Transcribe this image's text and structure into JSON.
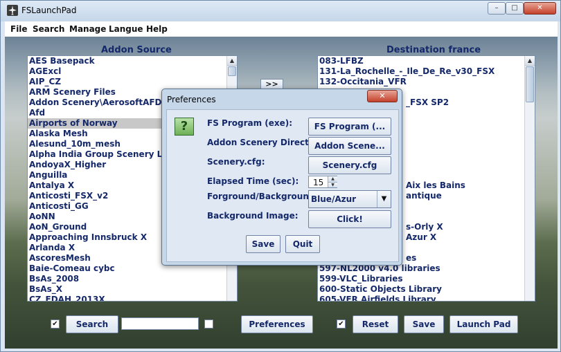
{
  "window": {
    "title": "FSLaunchPad",
    "controls": {
      "minimize": "–",
      "maximize": "□",
      "close": "✕"
    }
  },
  "menu": [
    "File",
    "Search",
    "Manage",
    "Langue",
    "Help"
  ],
  "source": {
    "title": "Addon Source",
    "items": [
      "AES Basepack",
      "AGExcl",
      "AIP_CZ",
      "ARM Scenery Files",
      "Addon Scenery\\AerosoftAFD",
      "Afd",
      "Airports of Norway",
      "Alaska Mesh",
      "Alesund_10m_mesh",
      "Alpha India Group Scenery Landclass",
      "AndoyaX_Higher",
      "Anguilla",
      "Antalya X",
      "Anticosti_FSX_v2",
      "Anticosti_GG",
      "AoNN",
      "AoN_Ground",
      "Approaching Innsbruck X",
      "Arlanda X",
      "AscoresMesh",
      "Baie-Comeau cybc",
      "BsAs_2008",
      "BsAs_X",
      "CZ_EDAH_2013X"
    ],
    "selected_index": 6
  },
  "destination": {
    "title": "Destination france",
    "items_top": [
      "083-LFBZ",
      "131-La_Rochelle_-_Ile_De_Re_v30_FSX",
      "132-Occitania_VFR"
    ],
    "partial_visible": [
      {
        "text": "_FSX SP2",
        "row": 4
      },
      {
        "text": "Aix les Bains",
        "row": 12
      },
      {
        "text": "antique",
        "row": 13
      },
      {
        "text": "s-Orly X",
        "row": 16
      },
      {
        "text": "Azur X",
        "row": 17
      },
      {
        "text": "es",
        "row": 19
      }
    ],
    "items_bottom": [
      "597-NL2000 v4.0 libraries",
      "599-VLC_Libraries",
      "600-Static Objects Library",
      "605-VFR Airfields Library"
    ]
  },
  "transfer_button": ">>",
  "toolbar": {
    "search_checked": true,
    "search_label": "Search",
    "search_value": "",
    "option_checked": false,
    "preferences_label": "Preferences",
    "reset_checked": true,
    "reset_label": "Reset",
    "save_label": "Save",
    "launch_label": "Launch Pad"
  },
  "dialog": {
    "title": "Preferences",
    "close": "✕",
    "icon_glyph": "?",
    "fs_program": {
      "label": "FS Program (exe):",
      "button": "FS Program (..."
    },
    "addon_dir": {
      "label": "Addon Scenery Directory:",
      "button": "Addon Scene..."
    },
    "scenery_cfg": {
      "label": "Scenery.cfg:",
      "button": "Scenery.cfg"
    },
    "elapsed": {
      "label": "Elapsed Time (sec):",
      "value": "15"
    },
    "colors": {
      "label": "Forground/Background:",
      "value": "Blue/Azur"
    },
    "background": {
      "label": "Background Image:",
      "button": "Click!"
    },
    "save_label": "Save",
    "quit_label": "Quit"
  }
}
